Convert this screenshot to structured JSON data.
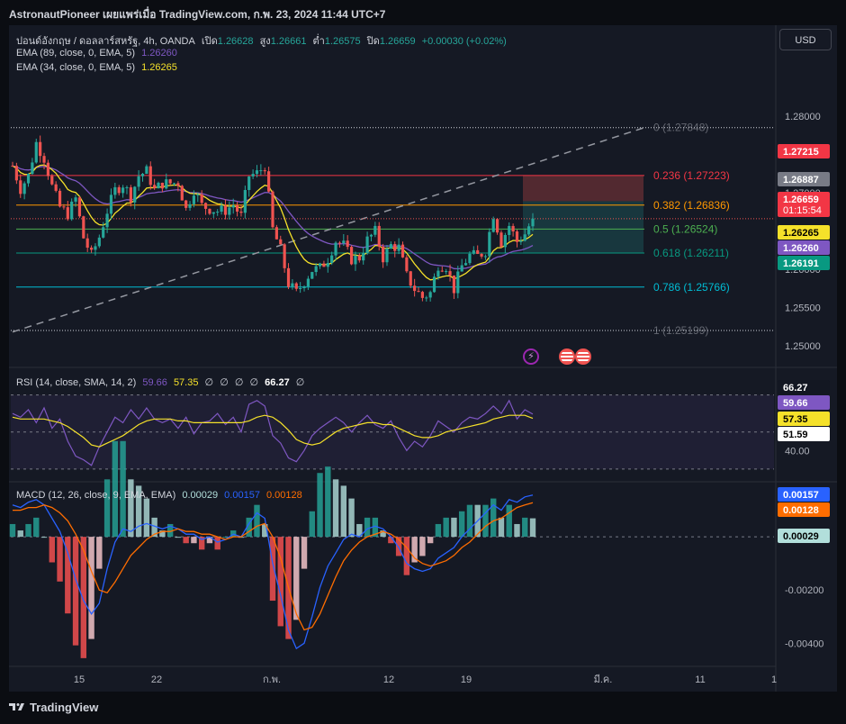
{
  "header": {
    "title": "AstronautPioneer เผยแพร่เมื่อ TradingView.com, ก.พ. 23, 2024 11:44 UTC+7"
  },
  "legend": {
    "symbol": "ปอนด์อังกฤษ / ดอลลาร์สหรัฐ, 4h, OANDA",
    "open_label": "เปิด",
    "open": "1.26628",
    "high_label": "สูง",
    "high": "1.26661",
    "low_label": "ต่ำ",
    "low": "1.26575",
    "close_label": "ปิด",
    "close": "1.26659",
    "change": "+0.00030 (+0.02%)",
    "ema89_label": "EMA (89, close, 0, EMA, 5)",
    "ema89_value": "1.26260",
    "ema34_label": "EMA (34, close, 0, EMA, 5)",
    "ema34_value": "1.26265",
    "rsi_label": "RSI (14, close, SMA, 14, 2)",
    "rsi_value": "59.66",
    "rsi_sma": "57.35",
    "rsi_extra": [
      "∅",
      "∅",
      "∅",
      "∅"
    ],
    "rsi_bold": "66.27",
    "rsi_extra2": "∅",
    "macd_label": "MACD (12, 26, close, 9, EMA, EMA)",
    "macd_hist": "0.00029",
    "macd_line": "0.00157",
    "macd_signal": "0.00128"
  },
  "currency_button": "USD",
  "branding": "TradingView",
  "colors": {
    "up": "#26a69a",
    "down": "#ef5350",
    "ema34": "#f5e12a",
    "ema89": "#7e57c2",
    "macd": "#2962ff",
    "signal": "#ff6d00",
    "rsi": "#7e57c2"
  },
  "chart_data": [
    {
      "type": "candlestick",
      "title": "ปอนด์อังกฤษ / ดอลลาร์สหรัฐ, 4h, OANDA",
      "x_ticks": [
        "15",
        "22",
        "ก.พ.",
        "12",
        "19",
        "มี.ค.",
        "11",
        "1"
      ],
      "y_ticks": [
        "1.28000",
        "1.27500",
        "1.27000",
        "1.26500",
        "1.26000",
        "1.25500",
        "1.25000"
      ],
      "ylim": [
        1.2487,
        1.2855
      ],
      "fib_levels": [
        {
          "ratio": "0",
          "value": 1.27848,
          "label": "0 (1.27848)"
        },
        {
          "ratio": "0.236",
          "value": 1.27223,
          "label": "0.236 (1.27223)"
        },
        {
          "ratio": "0.382",
          "value": 1.26836,
          "label": "0.382 (1.26836)"
        },
        {
          "ratio": "0.5",
          "value": 1.26524,
          "label": "0.5 (1.26524)"
        },
        {
          "ratio": "0.618",
          "value": 1.26211,
          "label": "0.618 (1.26211)"
        },
        {
          "ratio": "0.786",
          "value": 1.25766,
          "label": "0.786 (1.25766)"
        },
        {
          "ratio": "1",
          "value": 1.25199,
          "label": "1 (1.25199)"
        }
      ],
      "price_tags": [
        {
          "value": 1.27215,
          "label": "1.27215"
        },
        {
          "value": 1.26887,
          "label": "1.26887"
        },
        {
          "value": 1.26659,
          "label": "1.26659",
          "sub": "01:15:54"
        },
        {
          "value": 1.26265,
          "label": "1.26265"
        },
        {
          "value": 1.2626,
          "label": "1.26260"
        },
        {
          "value": 1.26191,
          "label": "1.26191"
        }
      ],
      "series": [
        {
          "name": "GBPUSD",
          "close_path": [
            1.2735,
            1.2705,
            1.2722,
            1.2765,
            1.2745,
            1.2708,
            1.2681,
            1.2672,
            1.2692,
            1.2641,
            1.2618,
            1.2642,
            1.2676,
            1.2703,
            1.2711,
            1.2695,
            1.2722,
            1.2728,
            1.2703,
            1.2712,
            1.2712,
            1.2713,
            1.2678,
            1.2704,
            1.2683,
            1.2679,
            1.2676,
            1.2677,
            1.2684,
            1.2669,
            1.2722,
            1.2725,
            1.2735,
            1.2652,
            1.2625,
            1.2581,
            1.2569,
            1.2584,
            1.2599,
            1.2601,
            1.2614,
            1.2637,
            1.2631,
            1.2613,
            1.2615,
            1.2638,
            1.2649,
            1.2615,
            1.2631,
            1.2628,
            1.2591,
            1.2574,
            1.2563,
            1.2569,
            1.2606,
            1.2604,
            1.2574,
            1.2604,
            1.2618,
            1.2617,
            1.2624,
            1.2672,
            1.2635,
            1.2657,
            1.2636,
            1.2646,
            1.2666
          ]
        }
      ]
    },
    {
      "type": "line",
      "title": "RSI (14, close, SMA, 14, 2)",
      "y_ticks": [
        "40.00"
      ],
      "ylim": [
        28,
        80
      ],
      "price_tags": [
        {
          "value": 66.27,
          "label": "66.27"
        },
        {
          "value": 59.66,
          "label": "59.66"
        },
        {
          "value": 57.35,
          "label": "57.35"
        },
        {
          "value": 51.59,
          "label": "51.59"
        }
      ],
      "series": [
        {
          "name": "RSI",
          "values": [
            60,
            58,
            62,
            55,
            63,
            52,
            57,
            45,
            37,
            35,
            32,
            42,
            50,
            58,
            55,
            62,
            57,
            63,
            57,
            55,
            57,
            52,
            58,
            49,
            55,
            56,
            60,
            54,
            58,
            50,
            65,
            67,
            64,
            48,
            44,
            36,
            34,
            40,
            48,
            52,
            55,
            58,
            55,
            50,
            55,
            59,
            54,
            52,
            56,
            47,
            40,
            45,
            42,
            48,
            56,
            53,
            50,
            55,
            58,
            57,
            60,
            64,
            60,
            67,
            57,
            62,
            59.66
          ]
        },
        {
          "name": "RSI-based MA",
          "values": [
            58,
            57,
            57,
            57,
            57,
            56,
            55,
            53,
            50,
            47,
            43,
            42,
            44,
            46,
            48,
            51,
            54,
            56,
            57,
            57,
            57,
            56,
            56,
            55,
            55,
            55,
            55,
            55,
            55,
            55,
            56,
            58,
            59,
            58,
            55,
            51,
            46,
            44,
            43,
            44,
            47,
            50,
            52,
            53,
            54,
            55,
            55,
            54,
            54,
            52,
            50,
            48,
            47,
            47,
            48,
            50,
            51,
            52,
            53,
            54,
            55,
            57,
            58,
            59,
            59,
            59,
            57.35
          ]
        }
      ]
    },
    {
      "type": "bar",
      "title": "MACD (12, 26, close, 9, EMA, EMA)",
      "y_ticks": [
        "-0.00200",
        "-0.00400"
      ],
      "ylim": [
        -0.0047,
        0.0019
      ],
      "price_tags": [
        {
          "value": 0.00157,
          "label": "0.00157"
        },
        {
          "value": 0.00128,
          "label": "0.00128"
        },
        {
          "value": 0.00029,
          "label": "0.00029"
        }
      ],
      "series": [
        {
          "name": "MACD",
          "values": [
            0.0012,
            0.0011,
            0.0013,
            0.0014,
            0.0012,
            0.0007,
            0.0002,
            -0.0006,
            -0.0016,
            -0.0024,
            -0.0029,
            -0.0025,
            -0.0012,
            -0.0002,
            0.0003,
            0.0002,
            0.0004,
            0.0005,
            0.0004,
            0.0003,
            0.0004,
            0.0003,
            0.0001,
            0.0001,
            -0.0001,
            0.0,
            -0.0002,
            -0.0001,
            0.0001,
            0.0,
            0.0005,
            0.0009,
            0.0007,
            -0.001,
            -0.0022,
            -0.0035,
            -0.0042,
            -0.004,
            -0.003,
            -0.0019,
            -0.0011,
            -0.0006,
            -0.0001,
            0.0001,
            0.0,
            0.0003,
            0.0004,
            0.0003,
            0.0,
            -0.0004,
            -0.001,
            -0.0012,
            -0.0013,
            -0.0012,
            -0.0008,
            -0.0006,
            -0.0004,
            0.0,
            0.0003,
            0.0006,
            0.0009,
            0.0012,
            0.001,
            0.0014,
            0.0013,
            0.0015,
            0.00157
          ]
        },
        {
          "name": "Signal",
          "values": [
            0.001,
            0.001,
            0.0011,
            0.0011,
            0.0012,
            0.0011,
            0.0009,
            0.0006,
            0.0001,
            -0.0005,
            -0.0013,
            -0.002,
            -0.0021,
            -0.0017,
            -0.0012,
            -0.0007,
            -0.0004,
            -0.0001,
            0.0001,
            0.0002,
            0.0002,
            0.0003,
            0.0002,
            0.0002,
            0.0001,
            0.0001,
            0.0,
            -0.0001,
            0.0,
            0.0,
            0.0002,
            0.0004,
            0.0005,
            0.0,
            -0.0008,
            -0.0019,
            -0.0029,
            -0.0035,
            -0.0034,
            -0.0029,
            -0.0022,
            -0.0015,
            -0.0009,
            -0.0005,
            -0.0002,
            0.0,
            0.0001,
            0.0002,
            0.0001,
            -0.0001,
            -0.0004,
            -0.0008,
            -0.001,
            -0.0011,
            -0.001,
            -0.0009,
            -0.0007,
            -0.0004,
            -0.0002,
            0.0001,
            0.0004,
            0.0006,
            0.0007,
            0.0009,
            0.0011,
            0.0012,
            0.00128
          ]
        }
      ]
    }
  ]
}
